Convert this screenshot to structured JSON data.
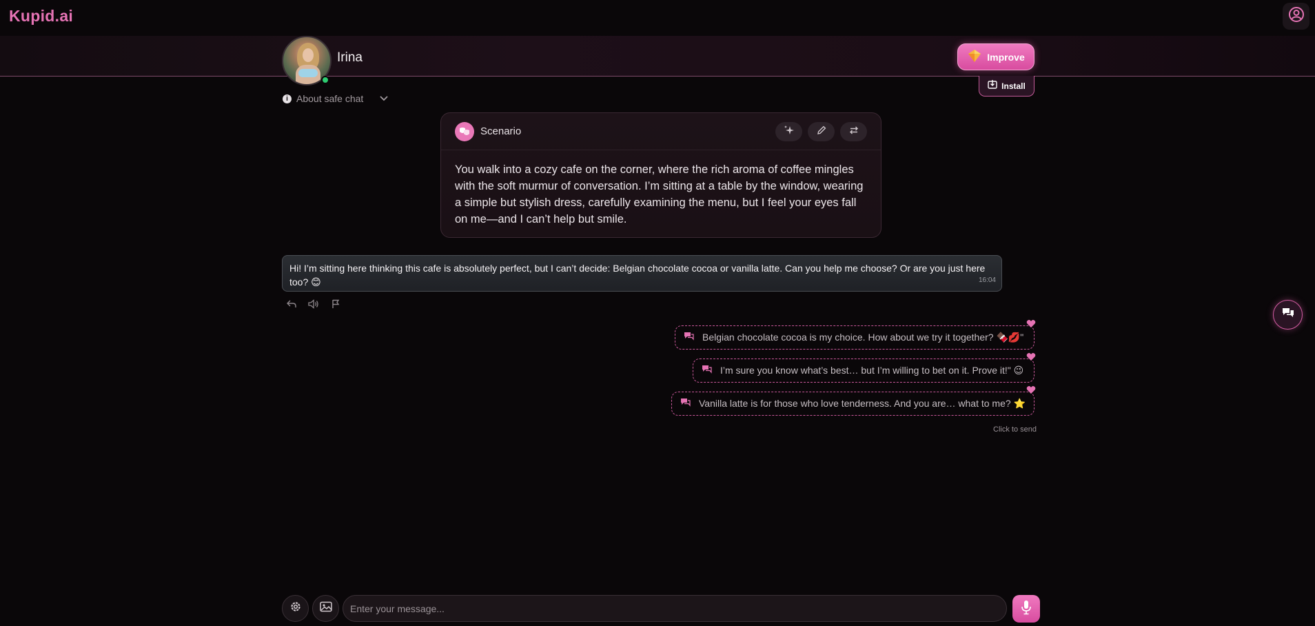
{
  "app": {
    "logo": "Kupid.ai"
  },
  "header": {
    "character_name": "Irina",
    "improve_label": "Improve",
    "install_label": "Install",
    "about_safe_chat": "About safe chat"
  },
  "scenario": {
    "title": "Scenario",
    "text": "You walk into a cozy cafe on the corner, where the rich aroma of coffee mingles with the soft murmur of conversation. I’m sitting at a table by the window, wearing a simple but stylish dress, carefully examining the menu, but I feel your eyes fall on me—and I can’t help but smile."
  },
  "message": {
    "text": "Hi! I’m sitting here thinking this cafe is absolutely perfect, but I can’t decide: Belgian chocolate cocoa or vanilla latte. Can you help me choose? Or are you just here too? 😊",
    "time": "16:04"
  },
  "suggestions": [
    {
      "text": "Belgian chocolate cocoa is my choice. How about we try it together? 🍫💋\""
    },
    {
      "text": "I’m sure you know what’s best… but I’m willing to bet on it. Prove it!\" 😉"
    },
    {
      "text": "Vanilla latte is for those who love tenderness. And you are… what to me? ⭐"
    }
  ],
  "click_to_send": "Click to send",
  "input": {
    "placeholder": "Enter your message..."
  },
  "colors": {
    "accent": "#e573b4",
    "online": "#2ecc71",
    "background": "#0a0709"
  },
  "icons": {
    "account": "user-circle-icon",
    "info": "info-icon",
    "chevron": "chevron-down-icon",
    "scenario": "masks-icon",
    "sparkle": "sparkle-icon",
    "edit": "pencil-icon",
    "swap": "swap-icon",
    "reply": "reply-icon",
    "speaker": "speaker-icon",
    "flag": "flag-icon",
    "heart": "heart-icon",
    "chat": "chat-bubbles-icon",
    "settings": "gear-icon",
    "image": "image-icon",
    "mic": "microphone-icon"
  }
}
